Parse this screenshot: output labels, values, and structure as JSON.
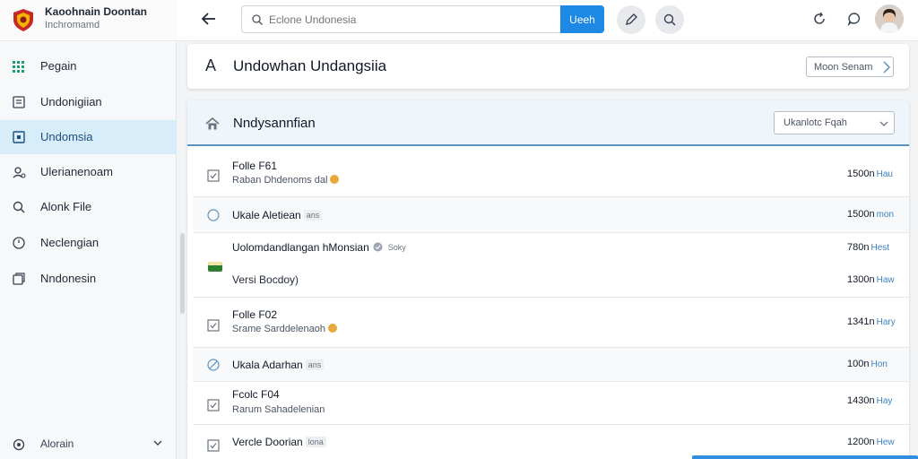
{
  "brand": {
    "title": "Kaoohnain Doontan",
    "subtitle": "Inchromamd"
  },
  "sidebar": {
    "items": [
      {
        "label": "Pegain",
        "icon": "grid-icon"
      },
      {
        "label": "Undonigiian",
        "icon": "document-icon"
      },
      {
        "label": "Undomsia",
        "icon": "square-icon",
        "active": true
      },
      {
        "label": "Ulerianenoam",
        "icon": "user-icon"
      },
      {
        "label": "Alonk File",
        "icon": "search-icon"
      },
      {
        "label": "Neclengian",
        "icon": "clock-icon"
      },
      {
        "label": "Nndonesin",
        "icon": "copy-icon"
      }
    ],
    "footer": {
      "label": "Alorain",
      "icon": "settings-icon"
    }
  },
  "topbar": {
    "search_placeholder": "Eclone Undonesia",
    "search_button": "Ueeh"
  },
  "header_panel": {
    "letter": "A",
    "title": "Undowhan Undangsiia",
    "next_button": "Moon Senam"
  },
  "list_panel": {
    "title": "Nndysannfian",
    "filter_value": "Ukanlotc Fqah",
    "rows": [
      {
        "title": "Folle F61",
        "subtitle": "Raban Dhdenoms dal",
        "size": "1500n",
        "unit": "Hau",
        "icon": "checkbox-icon",
        "coin": true
      },
      {
        "title": "Ukale Aletiean",
        "tag": "ans",
        "size": "1500n",
        "unit": "mon",
        "icon": "circle-icon"
      },
      {
        "title": "Uolomdandlangan hMonsian",
        "tag": "Soky",
        "size": "780n",
        "unit": "Hest",
        "icon": "package-icon",
        "verified": true
      },
      {
        "title": "",
        "subtitle": "Versi Bocdoy)",
        "size": "1300n",
        "unit": "Haw",
        "icon": ""
      },
      {
        "title": "Folle F02",
        "subtitle": "Srame Sarddelenaoh",
        "size": "1341n",
        "unit": "Hary",
        "icon": "checkbox-icon",
        "coin": true
      },
      {
        "title": "Ukala Adarhan",
        "tag": "ans",
        "size": "100n",
        "unit": "Hon",
        "icon": "slash-circle-icon"
      },
      {
        "title": "Fcolc F04",
        "subtitle": "Rarum Sahadelenian",
        "size": "1430n",
        "unit": "Hay",
        "icon": "checkbox-icon"
      },
      {
        "title": "Vercle Doorian",
        "tag": "lona",
        "size": "1200n",
        "unit": "Hew",
        "icon": "checkbox-icon"
      }
    ]
  },
  "colors": {
    "accent": "#1e88e5",
    "active_nav": "#d7edf9",
    "panel_header": "#eef6fb"
  }
}
